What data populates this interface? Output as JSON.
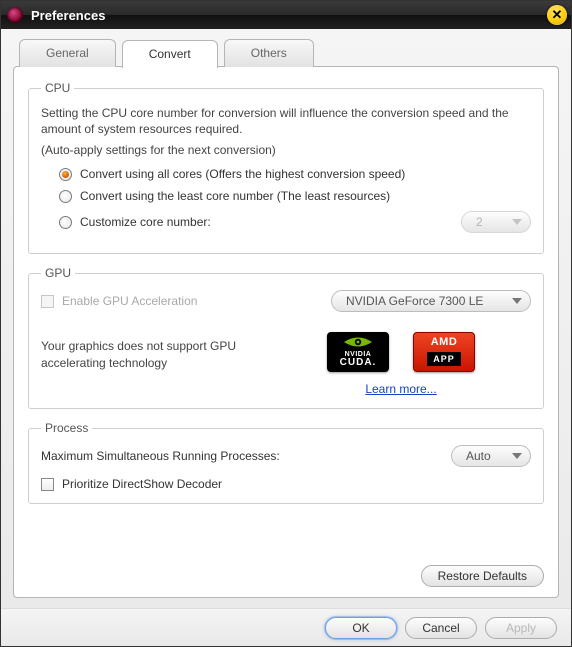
{
  "window": {
    "title": "Preferences"
  },
  "tabs": {
    "general": "General",
    "convert": "Convert",
    "others": "Others",
    "active": "convert"
  },
  "cpu": {
    "legend": "CPU",
    "description": "Setting the CPU core number for conversion will influence the conversion speed and the amount of system resources required.",
    "auto_apply": "(Auto-apply settings for the next conversion)",
    "opt_all": "Convert using all cores (Offers the highest conversion speed)",
    "opt_least": "Convert using the least core number (The least resources)",
    "opt_custom": "Customize core number:",
    "core_value": "2",
    "selected": "all"
  },
  "gpu": {
    "legend": "GPU",
    "enable_label": "Enable GPU Acceleration",
    "enable_checked": false,
    "enable_disabled": true,
    "device": "NVIDIA GeForce 7300 LE",
    "note": "Your graphics does not support GPU accelerating technology",
    "nvidia_brand": "NVIDIA",
    "nvidia_cuda": "CUDA.",
    "amd_brand": "AMD",
    "amd_app": "APP",
    "learn_more": "Learn more..."
  },
  "process": {
    "legend": "Process",
    "max_label": "Maximum Simultaneous Running Processes:",
    "max_value": "Auto",
    "prioritize_label": "Prioritize DirectShow Decoder",
    "prioritize_checked": false
  },
  "buttons": {
    "restore": "Restore Defaults",
    "ok": "OK",
    "cancel": "Cancel",
    "apply": "Apply"
  }
}
